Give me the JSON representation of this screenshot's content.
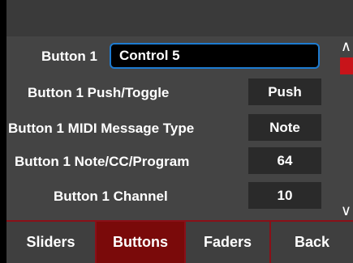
{
  "colors": {
    "accent": "#1e7bd0",
    "highlight": "#c8141a",
    "active_tab": "#7a0a0a"
  },
  "button_name": {
    "label": "Button 1",
    "value": "Control 5"
  },
  "settings": [
    {
      "label": "Button 1 Push/Toggle",
      "value": "Push"
    },
    {
      "label": "Button 1 MIDI Message Type",
      "value": "Note"
    },
    {
      "label": "Button 1 Note/CC/Program",
      "value": "64"
    },
    {
      "label": "Button 1 Channel",
      "value": "10"
    }
  ],
  "scrollbar": {
    "up_icon": "chevron-up-icon",
    "down_icon": "chevron-down-icon"
  },
  "tabs": [
    {
      "label": "Sliders",
      "active": false
    },
    {
      "label": "Buttons",
      "active": true
    },
    {
      "label": "Faders",
      "active": false
    },
    {
      "label": "Back",
      "active": false
    }
  ]
}
